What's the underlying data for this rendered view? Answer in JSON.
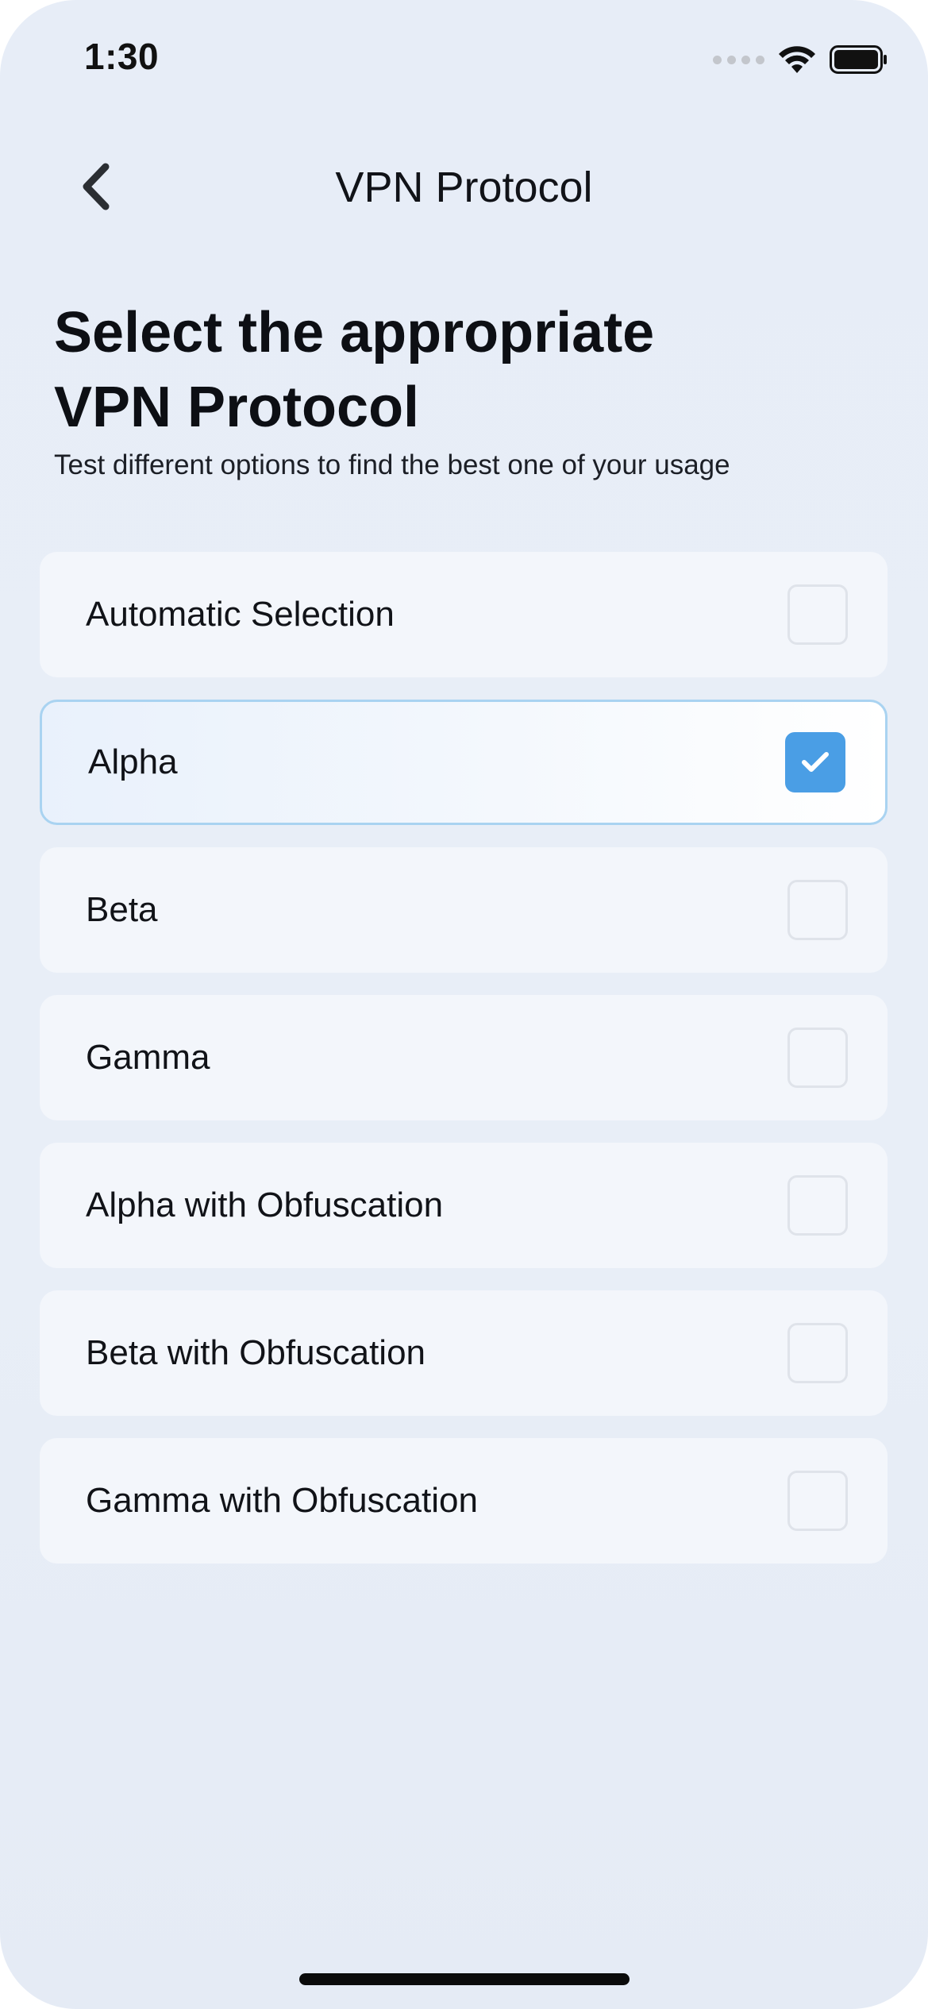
{
  "status_bar": {
    "time": "1:30"
  },
  "nav": {
    "title": "VPN Protocol",
    "back_icon": "chevron-left-icon"
  },
  "header": {
    "title_line1": "Select the appropriate",
    "title_line2": "VPN Protocol",
    "subtitle": "Test different options to find the best one of your usage"
  },
  "options": [
    {
      "label": "Automatic Selection",
      "checked": false
    },
    {
      "label": "Alpha",
      "checked": true
    },
    {
      "label": "Beta",
      "checked": false
    },
    {
      "label": "Gamma",
      "checked": false
    },
    {
      "label": "Alpha with Obfuscation",
      "checked": false
    },
    {
      "label": "Beta with Obfuscation",
      "checked": false
    },
    {
      "label": "Gamma with Obfuscation",
      "checked": false
    }
  ],
  "colors": {
    "accent": "#4a9ee5",
    "selected_border": "#a9d3f1",
    "card_bg": "#f3f6fb",
    "page_bg": "#e7edf7"
  }
}
